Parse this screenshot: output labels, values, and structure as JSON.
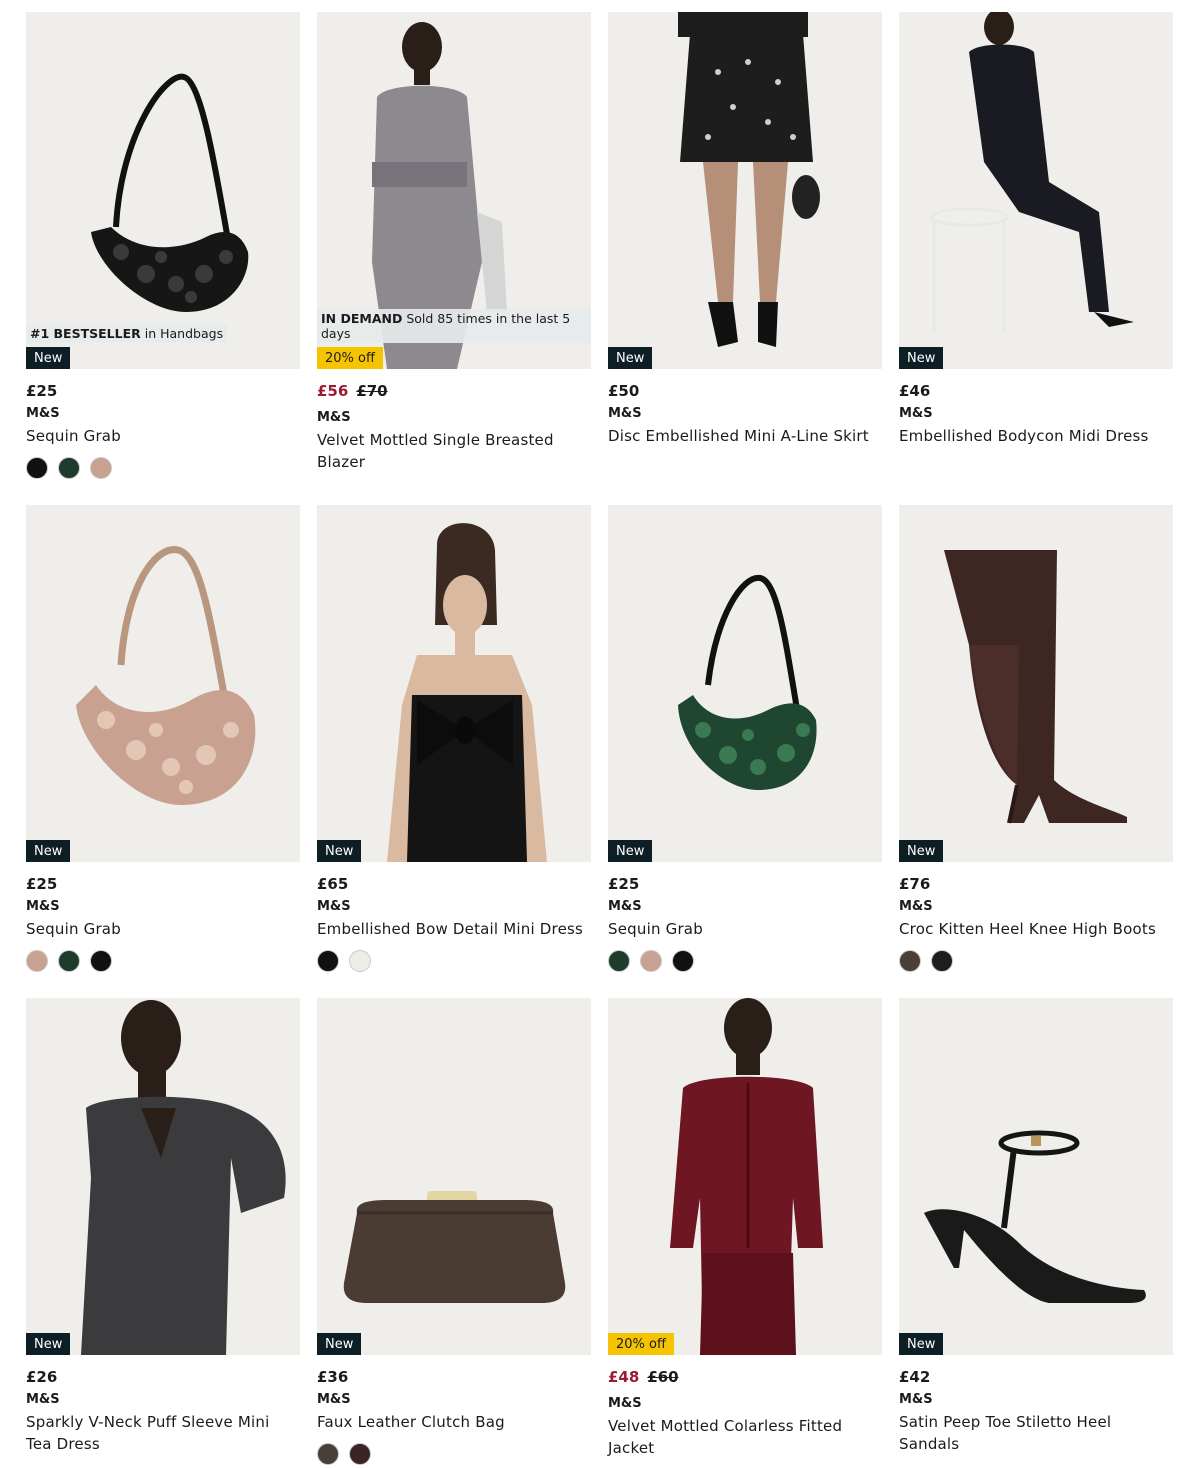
{
  "products": [
    {
      "price": "£25",
      "price_was": "",
      "brand": "M&S",
      "name": "Sequin Grab",
      "badge": "New",
      "insight_strong": "#1 BESTSELLER",
      "insight_rest": "in Handbags",
      "swatches": [
        "#111111",
        "#1f3b2c",
        "#c9a191"
      ],
      "image_icon": "sequin-handbag-icon"
    },
    {
      "price": "£56",
      "price_was": "£70",
      "brand": "M&S",
      "name": "Velvet Mottled Single Breasted Blazer",
      "badge": "20% off",
      "insight_strong": "IN DEMAND",
      "insight_rest": "Sold 85 times in the last 5 days",
      "swatches": [],
      "image_icon": "blazer-model-icon"
    },
    {
      "price": "£50",
      "price_was": "",
      "brand": "M&S",
      "name": "Disc Embellished Mini A-Line Skirt",
      "badge": "New",
      "insight_strong": "",
      "insight_rest": "",
      "swatches": [],
      "image_icon": "skirt-model-icon"
    },
    {
      "price": "£46",
      "price_was": "",
      "brand": "M&S",
      "name": "Embellished Bodycon Midi Dress",
      "badge": "New",
      "insight_strong": "",
      "insight_rest": "",
      "swatches": [],
      "image_icon": "dress-model-icon"
    },
    {
      "price": "£25",
      "price_was": "",
      "brand": "M&S",
      "name": "Sequin Grab",
      "badge": "New",
      "insight_strong": "",
      "insight_rest": "",
      "swatches": [
        "#c9a191",
        "#1f3b2c",
        "#111111"
      ],
      "image_icon": "sequin-handbag-icon"
    },
    {
      "price": "£65",
      "price_was": "",
      "brand": "M&S",
      "name": "Embellished Bow Detail Mini Dress",
      "badge": "New",
      "insight_strong": "",
      "insight_rest": "",
      "swatches": [
        "#111111",
        "#eeeee8"
      ],
      "image_icon": "bow-dress-model-icon"
    },
    {
      "price": "£25",
      "price_was": "",
      "brand": "M&S",
      "name": "Sequin Grab",
      "badge": "New",
      "insight_strong": "",
      "insight_rest": "",
      "swatches": [
        "#1f3b2c",
        "#c9a191",
        "#111111"
      ],
      "image_icon": "sequin-handbag-icon"
    },
    {
      "price": "£76",
      "price_was": "",
      "brand": "M&S",
      "name": "Croc Kitten Heel Knee High Boots",
      "badge": "New",
      "insight_strong": "",
      "insight_rest": "",
      "swatches": [
        "#4a3e38",
        "#1e1e1e"
      ],
      "image_icon": "knee-boot-icon"
    },
    {
      "price": "£26",
      "price_was": "",
      "brand": "M&S",
      "name": "Sparkly V-Neck Puff Sleeve Mini Tea Dress",
      "badge": "New",
      "insight_strong": "",
      "insight_rest": "",
      "swatches": [],
      "image_icon": "tea-dress-model-icon"
    },
    {
      "price": "£36",
      "price_was": "",
      "brand": "M&S",
      "name": "Faux Leather Clutch Bag",
      "badge": "New",
      "insight_strong": "",
      "insight_rest": "",
      "swatches": [
        "#4a3e38",
        "#3a2325"
      ],
      "image_icon": "clutch-bag-icon"
    },
    {
      "price": "£48",
      "price_was": "£60",
      "brand": "M&S",
      "name": "Velvet Mottled Colarless Fitted Jacket",
      "badge": "20% off",
      "insight_strong": "",
      "insight_rest": "",
      "swatches": [],
      "image_icon": "velvet-jacket-model-icon"
    },
    {
      "price": "£42",
      "price_was": "",
      "brand": "M&S",
      "name": "Satin Peep Toe Stiletto Heel Sandals",
      "badge": "New",
      "insight_strong": "",
      "insight_rest": "",
      "swatches": [],
      "image_icon": "stiletto-sandal-icon"
    }
  ],
  "colors": {
    "sale_price": "#9b1b33",
    "new_badge": "#0d1f24",
    "offer_badge": "#f5c400",
    "image_bg": "#efeeeb"
  }
}
